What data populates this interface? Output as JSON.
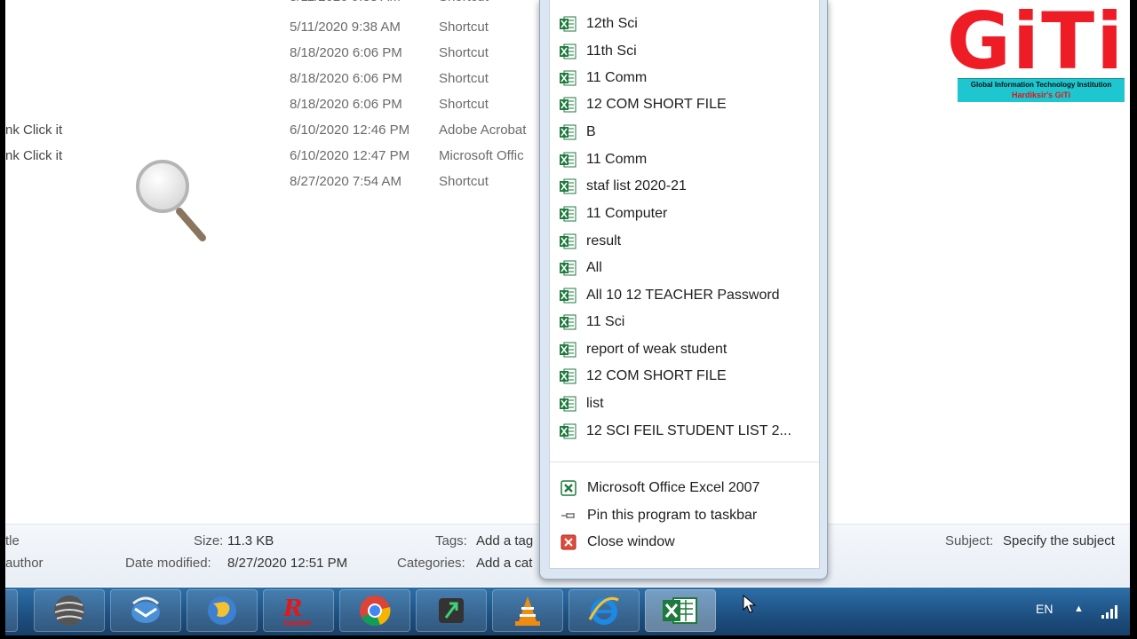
{
  "file_list": {
    "rows": [
      {
        "name": "",
        "date": "5/11/2020 9:38 AM",
        "type": "Shortcut"
      },
      {
        "name": "",
        "date": "8/18/2020 6:06 PM",
        "type": "Shortcut"
      },
      {
        "name": "",
        "date": "8/18/2020 6:06 PM",
        "type": "Shortcut"
      },
      {
        "name": "",
        "date": "8/18/2020 6:06 PM",
        "type": "Shortcut"
      },
      {
        "name": "nk Click it",
        "date": "6/10/2020 12:46 PM",
        "type": "Adobe Acrobat"
      },
      {
        "name": "nk Click it",
        "date": "6/10/2020 12:47 PM",
        "type": "Microsoft Offic"
      },
      {
        "name": "",
        "date": "8/27/2020 7:54 AM",
        "type": "Shortcut"
      }
    ]
  },
  "jumplist": {
    "recent": [
      "12th Sci",
      "11th Sci",
      "11 Comm",
      "12 COM SHORT FILE",
      "B",
      "11 Comm",
      "staf list 2020-21",
      "11 Computer",
      "result",
      "All",
      "All 10 12 TEACHER Password",
      "11 Sci",
      "report of weak student",
      "12 COM SHORT FILE",
      "list",
      "12 SCI FEIL STUDENT LIST 2..."
    ],
    "tasks": {
      "program": "Microsoft Office Excel 2007",
      "pin": "Pin this program to taskbar",
      "close": "Close window"
    }
  },
  "details_pane": {
    "title_label": "tle",
    "author_label": "author",
    "size_label": "Size:",
    "size_value": "11.3 KB",
    "modified_label": "Date modified:",
    "modified_value": "8/27/2020 12:51 PM",
    "tags_label": "Tags:",
    "tags_value": "Add a tag",
    "categories_label": "Categories:",
    "categories_value": "Add a cat",
    "subject_label": "Subject:",
    "subject_value": "Specify the subject"
  },
  "tray": {
    "language": "EN"
  },
  "logo": {
    "letters": "GiTi",
    "line1": "Global Information Technology Institution",
    "line2": "Hardiksir's GiTi"
  },
  "colors": {
    "excel_green": "#1e7a3c",
    "taskbar": "#1d4f80",
    "logo_red": "#ee1c25",
    "logo_band": "#1ec7cf"
  },
  "taskbar_icons": [
    "world-icon",
    "thunderbird-icon",
    "globe-icon",
    "rname-icon",
    "chrome-icon",
    "app-icon",
    "vlc-icon",
    "internet-explorer-icon",
    "excel-icon"
  ]
}
